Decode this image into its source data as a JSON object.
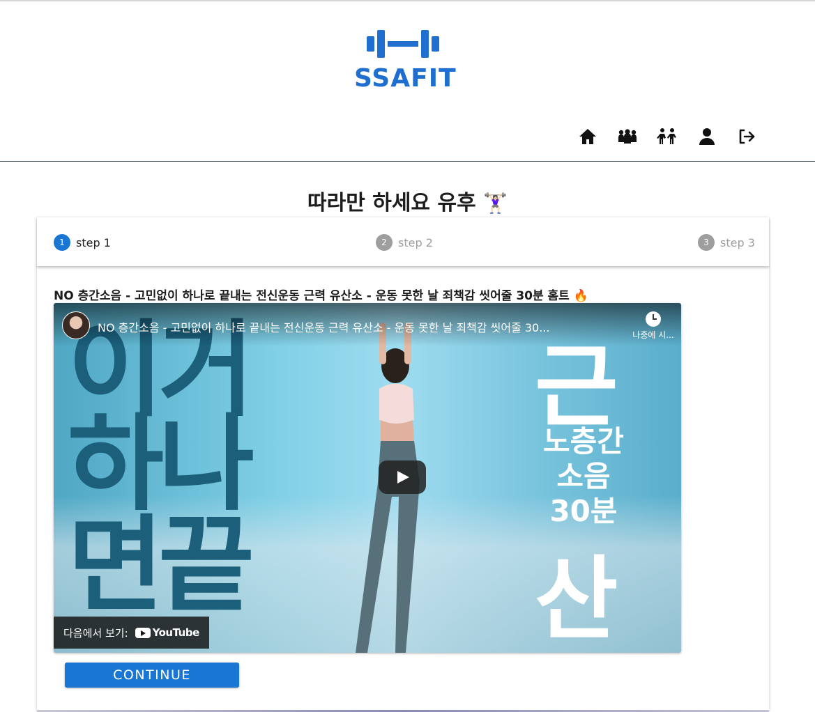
{
  "header": {
    "logo_text": "SSAFIT",
    "brand_color": "#1f6fd1",
    "nav_icons": [
      "home-icon",
      "group-icon",
      "fight-icon",
      "user-icon",
      "logout-icon"
    ]
  },
  "page": {
    "title": "따라만 하세요 유후",
    "title_emoji": "🏋🏻‍♀️"
  },
  "stepper": {
    "steps": [
      {
        "number": "1",
        "label": "step 1",
        "state": "active"
      },
      {
        "number": "2",
        "label": "step 2",
        "state": "inactive"
      },
      {
        "number": "3",
        "label": "step 3",
        "state": "inactive"
      }
    ],
    "active_color": "#1976d2"
  },
  "video": {
    "title": "NO 층간소음 - 고민없이 하나로 끝내는 전신운동 근력 유산소 - 운동 못한 날 죄책감 씻어줄 30분 홈트 🔥",
    "player_title": "NO 층간소음 - 고민없이 하나로 끝내는 전신운동 근력 유산소 - 운동 못한 날 죄책감 씻어줄 30...",
    "watch_later": "나중에 시...",
    "thumbnail_left_text": [
      "이거",
      "하나",
      "면끝"
    ],
    "thumbnail_right_text": [
      "노층간",
      "소음",
      "30분"
    ],
    "watch_on_label": "다음에서 보기:",
    "youtube_label": "YouTube"
  },
  "actions": {
    "continue_label": "CONTINUE"
  }
}
